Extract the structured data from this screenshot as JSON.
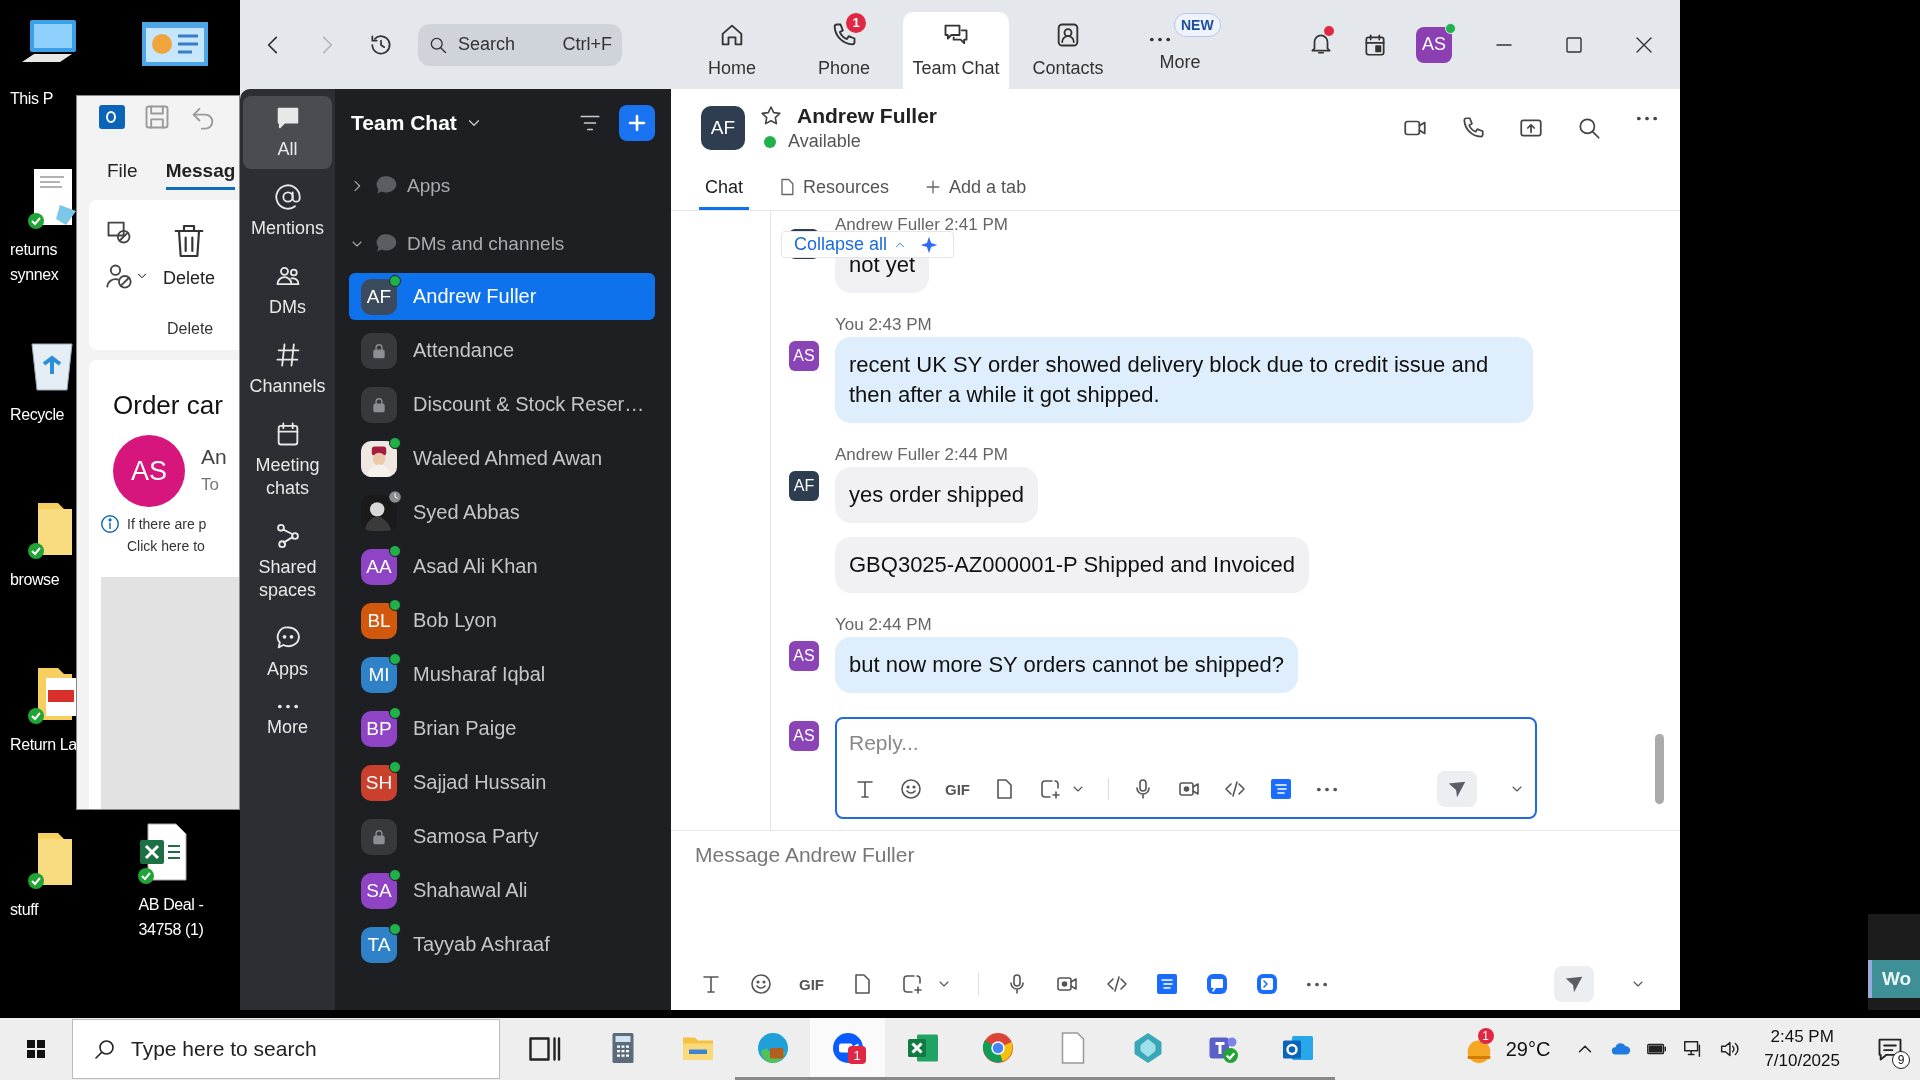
{
  "desktop": {
    "icons": [
      {
        "label": "This P",
        "synced": false
      },
      {
        "label": "returns synnex",
        "synced": true
      },
      {
        "label": "Recycle",
        "synced": false
      },
      {
        "label": "browse",
        "synced": true
      },
      {
        "label": "Return La",
        "synced": true
      },
      {
        "label": "stuff",
        "synced": true
      },
      {
        "label": "AB Deal - 34758 (1)",
        "synced": true
      },
      {
        "synced": false
      }
    ]
  },
  "outlook_window": {
    "tabs": [
      {
        "label": "File",
        "selected": false
      },
      {
        "label": "Messag",
        "selected": true
      }
    ],
    "delete_button": "Delete",
    "group_label": "Delete",
    "subject": "Order car",
    "sender_initials": "AS",
    "sender": "An",
    "recipient": "To",
    "info_lines": [
      "If there are p",
      "Click here to"
    ]
  },
  "zoom": {
    "top_bar": {
      "search": {
        "placeholder": "Search",
        "shortcut": "Ctrl+F"
      },
      "tabs": [
        {
          "label": "Home",
          "selected": false
        },
        {
          "label": "Phone",
          "selected": false,
          "badge": "1"
        },
        {
          "label": "Team Chat",
          "selected": true
        },
        {
          "label": "Contacts",
          "selected": false
        },
        {
          "label": "More",
          "selected": false,
          "badge": "NEW"
        }
      ],
      "notifications_unread": true,
      "avatar": {
        "initials": "AS",
        "online": true
      }
    },
    "rail": [
      {
        "label": "All",
        "selected": true
      },
      {
        "label": "Mentions",
        "selected": false
      },
      {
        "label": "DMs",
        "selected": false
      },
      {
        "label": "Channels",
        "selected": false
      },
      {
        "label": "Meeting chats",
        "selected": false
      },
      {
        "label": "Shared spaces",
        "selected": false
      },
      {
        "label": "Apps",
        "selected": false
      },
      {
        "label": "More",
        "selected": false
      }
    ],
    "list": {
      "title": "Team Chat",
      "sections": [
        {
          "label": "Apps",
          "expanded": false
        },
        {
          "label": "DMs and channels",
          "expanded": true
        }
      ],
      "items": [
        {
          "name": "Andrew Fuller",
          "kind": "initials",
          "initials": "AF",
          "color": "#3c4a5e",
          "online": true,
          "away": false,
          "selected": true
        },
        {
          "name": "Attendance",
          "kind": "lock",
          "online": false,
          "away": false,
          "selected": false
        },
        {
          "name": "Discount & Stock Reser…",
          "kind": "lock",
          "online": false,
          "away": false,
          "selected": false
        },
        {
          "name": "Waleed Ahmed Awan",
          "online": true,
          "away": false,
          "selected": false
        },
        {
          "name": "Syed Abbas",
          "online": false,
          "away": true,
          "selected": false
        },
        {
          "name": "Asad Ali Khan",
          "kind": "initials",
          "initials": "AA",
          "color": "#8e44c4",
          "online": true,
          "away": false,
          "selected": false
        },
        {
          "name": "Bob Lyon",
          "kind": "initials",
          "initials": "BL",
          "color": "#d2580d",
          "online": true,
          "away": false,
          "selected": false
        },
        {
          "name": "Musharaf Iqbal",
          "kind": "initials",
          "initials": "MI",
          "color": "#2f82c8",
          "online": true,
          "away": false,
          "selected": false
        },
        {
          "name": "Brian Paige",
          "kind": "initials",
          "initials": "BP",
          "color": "#8e44c4",
          "online": true,
          "away": false,
          "selected": false
        },
        {
          "name": "Sajjad Hussain",
          "kind": "initials",
          "initials": "SH",
          "color": "#c9402c",
          "online": true,
          "away": false,
          "selected": false
        },
        {
          "name": "Samosa Party",
          "kind": "lock",
          "online": false,
          "away": false,
          "selected": false
        },
        {
          "name": "Shahawal Ali",
          "kind": "initials",
          "initials": "SA",
          "color": "#8e44c4",
          "online": true,
          "away": false,
          "selected": false
        },
        {
          "name": "Tayyab Ashraaf",
          "kind": "initials",
          "initials": "TA",
          "color": "#2f82c8",
          "online": true,
          "away": false,
          "selected": false
        }
      ]
    },
    "chat": {
      "contact": {
        "initials": "AF",
        "name": "Andrew Fuller",
        "presence": "Available",
        "starred": false
      },
      "tabs": [
        {
          "label": "Chat",
          "selected": true
        },
        {
          "label": "Resources",
          "selected": false
        },
        {
          "label": "Add a tab",
          "selected": false
        }
      ],
      "collapse_label": "Collapse all",
      "messages": [
        {
          "sender": "Andrew Fuller",
          "time": "2:41 PM",
          "mine": false,
          "bubbles": [
            "not yet"
          ]
        },
        {
          "sender": "You",
          "time": "2:43 PM",
          "mine": true,
          "avatar": "AS",
          "bubbles": [
            "recent UK SY order showed delivery block due to credit issue and then after a while it got shipped."
          ]
        },
        {
          "sender": "Andrew Fuller",
          "time": "2:44 PM",
          "mine": false,
          "avatar": "AF",
          "bubbles": [
            "yes order shipped",
            "GBQ3025-AZ000001-P Shipped and Invoiced"
          ]
        },
        {
          "sender": "You",
          "time": "2:44 PM",
          "mine": true,
          "avatar": "AS",
          "bubbles": [
            "but now more SY orders cannot be shipped?"
          ]
        }
      ],
      "reply": {
        "avatar": "AS",
        "placeholder": "Reply...",
        "gif_label": "GIF"
      },
      "composer": {
        "placeholder": "Message Andrew Fuller",
        "gif_label": "GIF"
      }
    }
  },
  "side_button": "Wo",
  "taskbar": {
    "search_placeholder": "Type here to search",
    "apps": [
      {
        "open": false,
        "selected": false
      },
      {
        "open": false,
        "selected": false
      },
      {
        "open": true,
        "selected": false
      },
      {
        "open": true,
        "selected": true,
        "badge": "1"
      },
      {
        "open": true,
        "selected": false
      },
      {
        "open": true,
        "selected": false
      },
      {
        "open": true,
        "selected": false
      },
      {
        "open": true,
        "selected": false
      },
      {
        "open": true,
        "selected": false
      },
      {
        "open": true,
        "selected": false
      }
    ],
    "weather": {
      "badge": "1",
      "temperature": "29°C"
    },
    "clock": {
      "time": "2:45 PM",
      "date": "7/10/2025"
    },
    "notifications": "9"
  }
}
